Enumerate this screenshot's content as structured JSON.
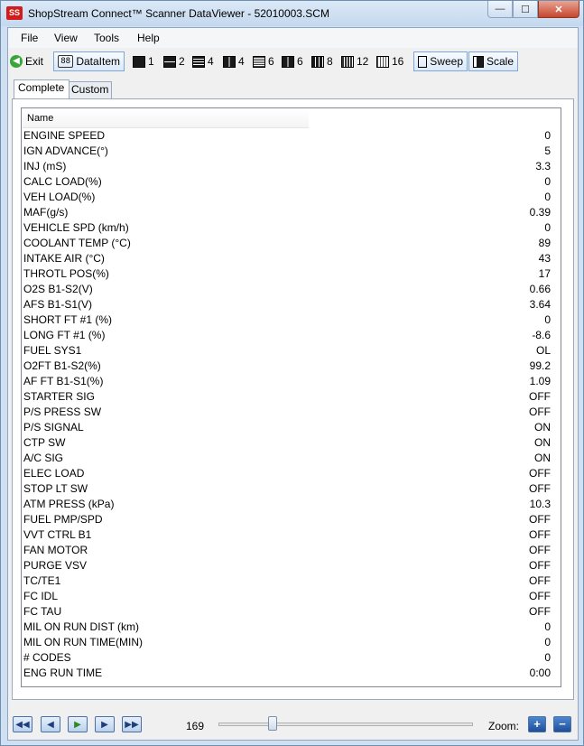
{
  "window": {
    "title": "ShopStream Connect™ Scanner DataViewer - 52010003.SCM",
    "app_icon": "ss-logo-icon",
    "controls": {
      "minimize": "—",
      "maximize": "☐",
      "close": "✕"
    }
  },
  "menu": [
    "File",
    "View",
    "Tools",
    "Help"
  ],
  "toolbar": {
    "exit_label": "Exit",
    "dataitem_label": "DataItem",
    "layouts": [
      "1",
      "2",
      "4",
      "4",
      "6",
      "6",
      "8",
      "12",
      "16"
    ],
    "sweep_label": "Sweep",
    "scale_label": "Scale"
  },
  "tabs": [
    {
      "label": "Complete",
      "active": true
    },
    {
      "label": "Custom",
      "active": false
    }
  ],
  "list": {
    "header_name": "Name",
    "rows": [
      {
        "name": "ENGINE SPEED",
        "value": "0"
      },
      {
        "name": "IGN ADVANCE(°)",
        "value": "5"
      },
      {
        "name": "INJ (mS)",
        "value": "3.3"
      },
      {
        "name": "CALC LOAD(%)",
        "value": "0"
      },
      {
        "name": "VEH LOAD(%)",
        "value": "0"
      },
      {
        "name": "MAF(g/s)",
        "value": "0.39"
      },
      {
        "name": "VEHICLE SPD (km/h)",
        "value": "0"
      },
      {
        "name": "COOLANT TEMP (°C)",
        "value": "89"
      },
      {
        "name": "INTAKE AIR (°C)",
        "value": "43"
      },
      {
        "name": "THROTL POS(%)",
        "value": "17"
      },
      {
        "name": "O2S B1-S2(V)",
        "value": "0.66"
      },
      {
        "name": "AFS B1-S1(V)",
        "value": "3.64"
      },
      {
        "name": "SHORT FT #1 (%)",
        "value": "0"
      },
      {
        "name": "LONG FT #1 (%)",
        "value": "-8.6"
      },
      {
        "name": "FUEL SYS1",
        "value": "OL"
      },
      {
        "name": "O2FT B1-S2(%)",
        "value": "99.2"
      },
      {
        "name": "AF FT B1-S1(%)",
        "value": "1.09"
      },
      {
        "name": "STARTER SIG",
        "value": "OFF"
      },
      {
        "name": "P/S PRESS SW",
        "value": "OFF"
      },
      {
        "name": "P/S SIGNAL",
        "value": "ON"
      },
      {
        "name": "CTP SW",
        "value": "ON"
      },
      {
        "name": "A/C SIG",
        "value": "ON"
      },
      {
        "name": "ELEC LOAD",
        "value": "OFF"
      },
      {
        "name": "STOP LT SW",
        "value": "OFF"
      },
      {
        "name": "ATM PRESS (kPa)",
        "value": "10.3"
      },
      {
        "name": "FUEL PMP/SPD",
        "value": "OFF"
      },
      {
        "name": "VVT CTRL B1",
        "value": "OFF"
      },
      {
        "name": "FAN MOTOR",
        "value": "OFF"
      },
      {
        "name": "PURGE VSV",
        "value": "OFF"
      },
      {
        "name": "TC/TE1",
        "value": "OFF"
      },
      {
        "name": "FC IDL",
        "value": "OFF"
      },
      {
        "name": "FC TAU",
        "value": "OFF"
      },
      {
        "name": "MIL ON RUN DIST (km)",
        "value": "0"
      },
      {
        "name": "MIL ON RUN TIME(MIN)",
        "value": "0"
      },
      {
        "name": "# CODES",
        "value": "0"
      },
      {
        "name": "ENG RUN TIME",
        "value": "0:00"
      }
    ]
  },
  "playback": {
    "position": "169",
    "slider_fraction": 0.2,
    "zoom_label": "Zoom:",
    "zoom_in": "+",
    "zoom_out": "−"
  }
}
